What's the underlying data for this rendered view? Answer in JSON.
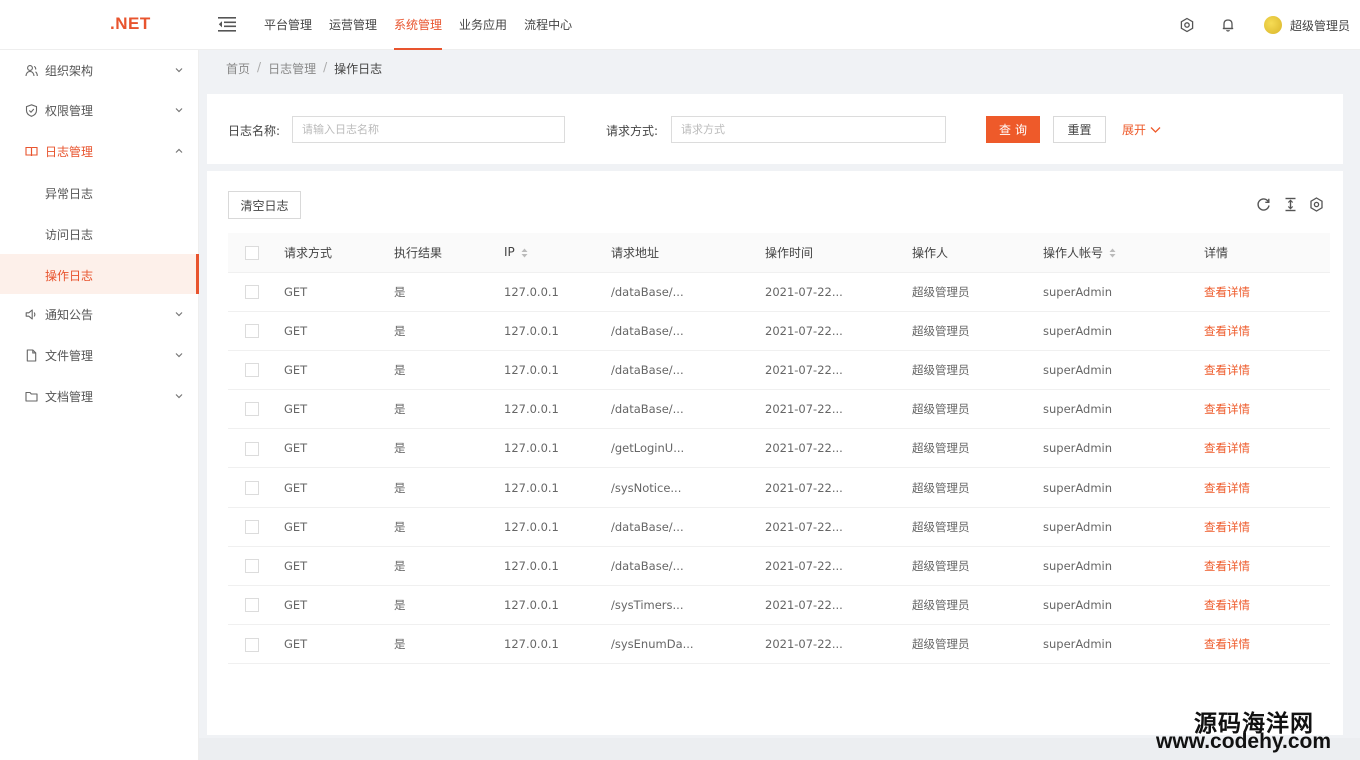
{
  "app": {
    "logo": ".NET"
  },
  "topnav": {
    "items": [
      {
        "label": "平台管理",
        "active": false
      },
      {
        "label": "运营管理",
        "active": false
      },
      {
        "label": "系统管理",
        "active": true
      },
      {
        "label": "业务应用",
        "active": false
      },
      {
        "label": "流程中心",
        "active": false
      }
    ],
    "icons": [
      "settings-icon",
      "bell-icon"
    ],
    "user": {
      "name": "超级管理员"
    }
  },
  "sidebar": {
    "items": [
      {
        "label": "组织架构",
        "icon": "org-icon",
        "expanded": false
      },
      {
        "label": "权限管理",
        "icon": "shield-icon",
        "expanded": false
      },
      {
        "label": "日志管理",
        "icon": "book-icon",
        "expanded": true,
        "children": [
          {
            "label": "异常日志",
            "active": false
          },
          {
            "label": "访问日志",
            "active": false
          },
          {
            "label": "操作日志",
            "active": true
          }
        ]
      },
      {
        "label": "通知公告",
        "icon": "speaker-icon",
        "expanded": false
      },
      {
        "label": "文件管理",
        "icon": "file-icon",
        "expanded": false
      },
      {
        "label": "文档管理",
        "icon": "folder-icon",
        "expanded": false
      }
    ]
  },
  "breadcrumb": [
    "首页",
    "日志管理",
    "操作日志"
  ],
  "search": {
    "log_name_label": "日志名称:",
    "log_name_placeholder": "请输入日志名称",
    "log_name_value": "",
    "method_label": "请求方式:",
    "method_placeholder": "请求方式",
    "method_value": "",
    "query_button": "查询",
    "reset_button": "重置",
    "expand_link": "展开"
  },
  "table": {
    "clear_button": "清空日志",
    "toolbar_icons": [
      "refresh-icon",
      "column-height-icon",
      "settings-icon"
    ],
    "columns": [
      "请求方式",
      "执行结果",
      "IP",
      "请求地址",
      "操作时间",
      "操作人",
      "操作人帐号",
      "详情"
    ],
    "rows": [
      [
        "GET",
        "是",
        "127.0.0.1",
        "/dataBase/...",
        "2021-07-22...",
        "超级管理员",
        "superAdmin",
        "查看详情"
      ],
      [
        "GET",
        "是",
        "127.0.0.1",
        "/dataBase/...",
        "2021-07-22...",
        "超级管理员",
        "superAdmin",
        "查看详情"
      ],
      [
        "GET",
        "是",
        "127.0.0.1",
        "/dataBase/...",
        "2021-07-22...",
        "超级管理员",
        "superAdmin",
        "查看详情"
      ],
      [
        "GET",
        "是",
        "127.0.0.1",
        "/dataBase/...",
        "2021-07-22...",
        "超级管理员",
        "superAdmin",
        "查看详情"
      ],
      [
        "GET",
        "是",
        "127.0.0.1",
        "/getLoginU...",
        "2021-07-22...",
        "超级管理员",
        "superAdmin",
        "查看详情"
      ],
      [
        "GET",
        "是",
        "127.0.0.1",
        "/sysNotice...",
        "2021-07-22...",
        "超级管理员",
        "superAdmin",
        "查看详情"
      ],
      [
        "GET",
        "是",
        "127.0.0.1",
        "/dataBase/...",
        "2021-07-22...",
        "超级管理员",
        "superAdmin",
        "查看详情"
      ],
      [
        "GET",
        "是",
        "127.0.0.1",
        "/dataBase/...",
        "2021-07-22...",
        "超级管理员",
        "superAdmin",
        "查看详情"
      ],
      [
        "GET",
        "是",
        "127.0.0.1",
        "/sysTimers...",
        "2021-07-22...",
        "超级管理员",
        "superAdmin",
        "查看详情"
      ],
      [
        "GET",
        "是",
        "127.0.0.1",
        "/sysEnumDa...",
        "2021-07-22...",
        "超级管理员",
        "superAdmin",
        "查看详情"
      ]
    ]
  },
  "watermark": {
    "cn": "源码海洋网",
    "url": "www.codehy.com"
  },
  "colors": {
    "accent": "#ee5a2a",
    "sidebar_active_bg": "#fdf0ea"
  }
}
